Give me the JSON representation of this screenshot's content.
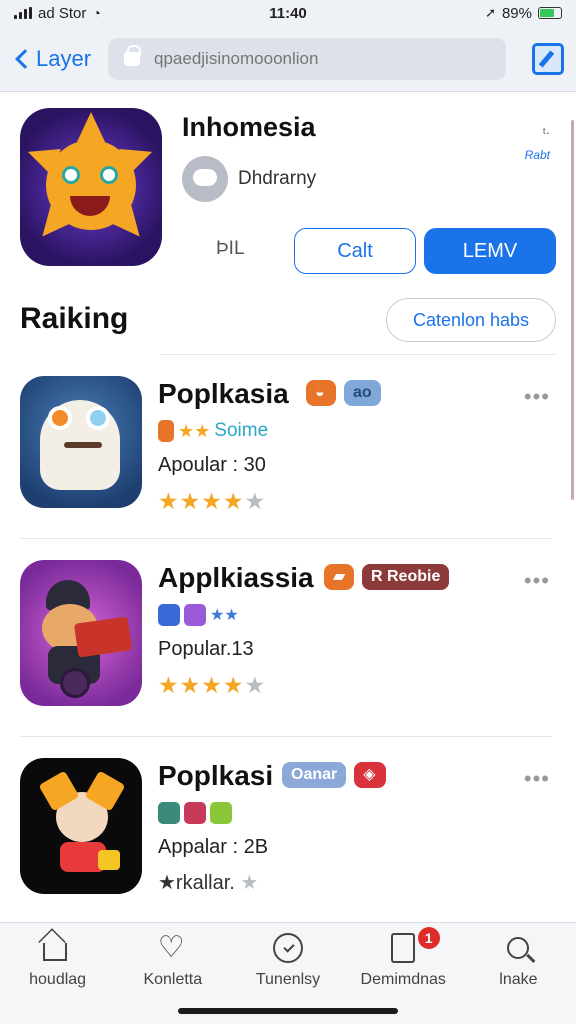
{
  "status_bar": {
    "carrier": "ad Stor",
    "time": "11:40",
    "battery": "89%"
  },
  "nav": {
    "back_label": "Layer",
    "search_placeholder": "qpaedjisinomooonlion"
  },
  "featured": {
    "title": "Inhomesia",
    "corner_top": "ᵗ·",
    "corner_rate": "Rabt",
    "developer": "Dhdrarny",
    "size": "ÞIL",
    "secondary_button": "Calt",
    "primary_button": "LEMV"
  },
  "ranking": {
    "title": "Raiking",
    "category_button": "Catenlon habs",
    "items": [
      {
        "title": "Poplkasia",
        "badges": [
          {
            "text": "",
            "color": "#e8742a"
          },
          {
            "text": "ao",
            "color": "#7fa8d8"
          }
        ],
        "subtitle": "Soime",
        "popular": "Apoular : 30",
        "stars_on": 4,
        "stars_text": ""
      },
      {
        "title": "Applkiassia",
        "badges": [
          {
            "text": "",
            "color": "#e8742a"
          },
          {
            "text": "R Reobie",
            "color": "#8c3a3a"
          }
        ],
        "subtitle": "",
        "popular": "Popular.13",
        "stars_on": 4,
        "stars_text": ""
      },
      {
        "title": "Poplkasi",
        "badges": [
          {
            "text": "Oanar",
            "color": "#8ca8d8"
          },
          {
            "text": "",
            "color": "#d8323a"
          }
        ],
        "subtitle": "",
        "popular": "Appalar : 2B",
        "stars_on": 0,
        "stars_text": "★rkallar."
      }
    ]
  },
  "tabs": [
    {
      "label": "houdlag",
      "icon": "home-icon"
    },
    {
      "label": "Konletta",
      "icon": "heart-icon"
    },
    {
      "label": "Tunenlsy",
      "icon": "clock-icon"
    },
    {
      "label": "Demimdnas",
      "icon": "document-icon",
      "badge": "1"
    },
    {
      "label": "lnake",
      "icon": "search-icon"
    }
  ]
}
